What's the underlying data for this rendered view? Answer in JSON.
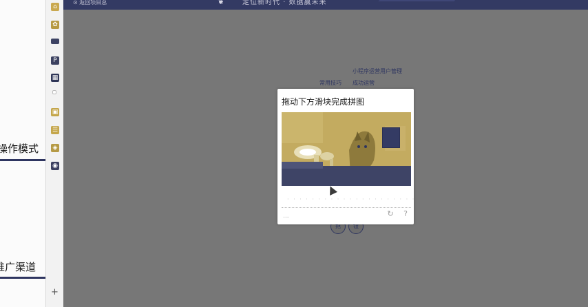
{
  "left_doc": {
    "heading_1": "操作模式",
    "heading_2": "推广渠道"
  },
  "icon_rail": {
    "icons": [
      {
        "name": "home-icon",
        "color": "#c9a84f"
      },
      {
        "name": "settings-icon",
        "color": "#b79a43"
      },
      {
        "name": "film-icon",
        "color": "#3c4263"
      },
      {
        "name": "puzzle-icon",
        "color": "#3b4160"
      },
      {
        "name": "grid-icon",
        "color": "#2f3657"
      },
      {
        "name": "dot-icon",
        "color": "#bcbcbc"
      },
      {
        "name": "folder-icon",
        "color": "#c4a64b"
      },
      {
        "name": "chat-icon",
        "color": "#c4a64b"
      },
      {
        "name": "tag-icon",
        "color": "#b59a45"
      },
      {
        "name": "eye-icon",
        "color": "#3b3f5f"
      }
    ],
    "add_label": "+"
  },
  "topbar": {
    "back_label": "⊙ 返回项目总",
    "slogan": "定位新时代 · 数据赢未来"
  },
  "background": {
    "line_1": "小程序运营用户管理",
    "line_2_left": "常用技巧",
    "line_2_right": "成功运营",
    "circle_1": "拖",
    "circle_2": "钮"
  },
  "captcha": {
    "title": "拖动下方滑块完成拼图",
    "slider_hint": "· · · · · · · · · · · · · · · · · · · · ·",
    "footer_left": "...",
    "refresh_icon": "↻",
    "help_icon": "?"
  },
  "colors": {
    "stage_overlay": "#777777",
    "topbar": "#333a63",
    "accent_navy": "#2e3560",
    "accent_gold": "#c6ad62"
  }
}
